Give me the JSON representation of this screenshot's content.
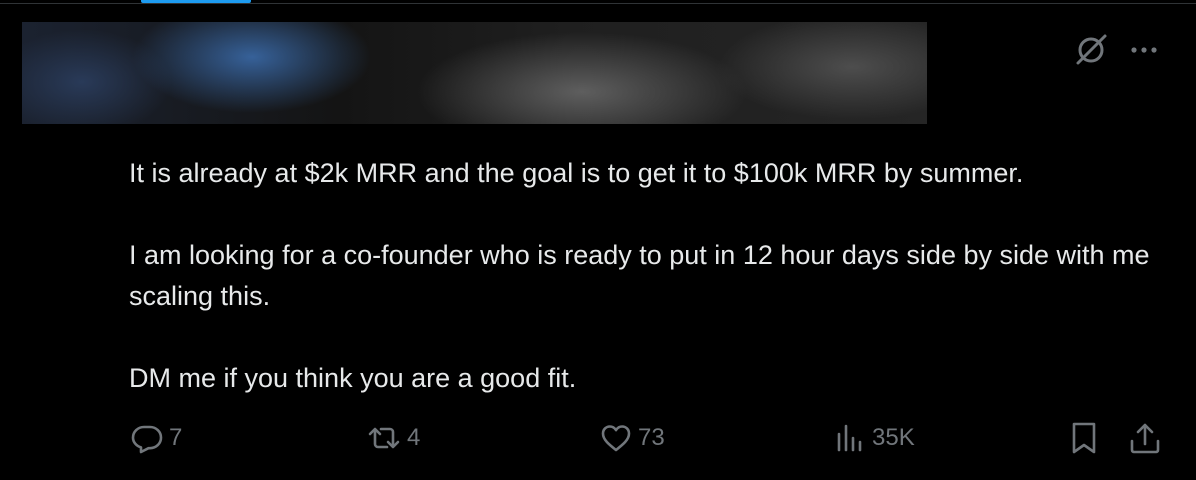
{
  "post": {
    "paragraphs": [
      "It is already at $2k MRR and the goal is to get it to $100k MRR by summer.",
      "I am looking for a co-founder who is ready to put in 12 hour days side by side with me scaling this.",
      "DM me if you think you are a good fit."
    ],
    "header_icons": {
      "grok": "grok-icon",
      "more": "more-icon"
    }
  },
  "actions": {
    "reply": {
      "icon": "reply-icon",
      "count": "7"
    },
    "repost": {
      "icon": "repost-icon",
      "count": "4"
    },
    "like": {
      "icon": "heart-icon",
      "count": "73"
    },
    "views": {
      "icon": "views-icon",
      "count": "35K"
    },
    "bookmark": {
      "icon": "bookmark-icon"
    },
    "share": {
      "icon": "share-icon"
    }
  },
  "colors": {
    "background": "#000000",
    "text": "#e7e9ea",
    "muted": "#71767b",
    "accent": "#1d9bf0"
  }
}
